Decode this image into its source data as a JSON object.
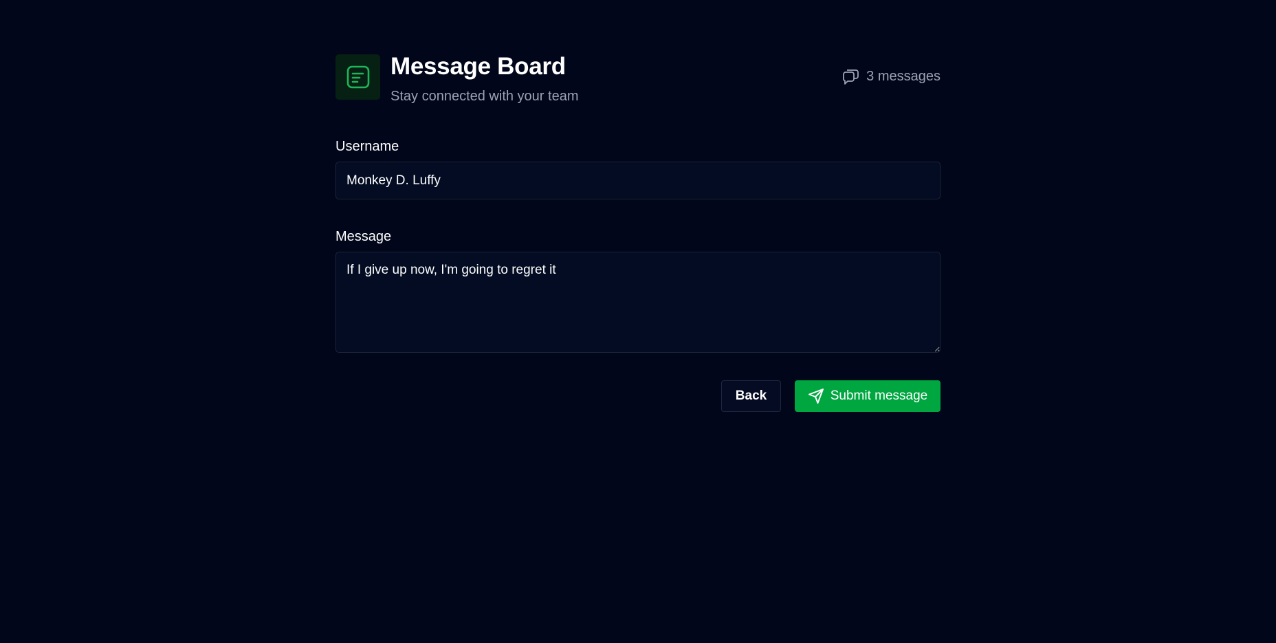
{
  "header": {
    "title": "Message Board",
    "subtitle": "Stay connected with your team",
    "logo_icon": "document-lines-icon",
    "message_count": "3 messages",
    "count_icon": "chat-bubbles-icon"
  },
  "form": {
    "username_label": "Username",
    "username_value": "Monkey D. Luffy",
    "message_label": "Message",
    "message_value": "If I give up now, I'm going to regret it"
  },
  "actions": {
    "back_label": "Back",
    "submit_label": "Submit message",
    "submit_icon": "send-icon"
  },
  "colors": {
    "background": "#02061a",
    "accent": "#00a640",
    "muted_text": "#9ca3b4"
  }
}
